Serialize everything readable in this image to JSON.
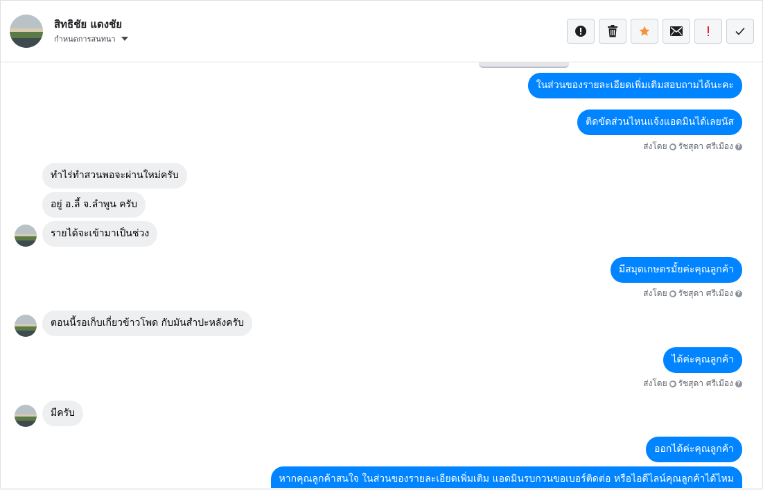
{
  "header": {
    "contact_name": "สิทธิชัย แดงชัย",
    "assign_label": "กำหนดการสนทนา",
    "avatar_icon": "landscape-avatar",
    "actions": [
      {
        "name": "report-spam-button",
        "icon": "exclamation-circle-icon"
      },
      {
        "name": "delete-button",
        "icon": "trash-icon"
      },
      {
        "name": "star-button",
        "icon": "star-icon"
      },
      {
        "name": "mark-unread-button",
        "icon": "envelope-icon"
      },
      {
        "name": "follow-up-button",
        "icon": "exclamation-icon"
      },
      {
        "name": "mark-done-button",
        "icon": "checkmark-icon"
      }
    ]
  },
  "colors": {
    "outgoing_bubble": "#0084ff",
    "incoming_bubble": "#eeeff1",
    "star": "#f7923b",
    "follow_up": "#e41e3f"
  },
  "messages": {
    "m1": "ในส่วนของรายละเอียดเพิ่มเติมสอบถามได้นะคะ",
    "m2": "ติดขัดส่วนไหนแจ้งแอดมินได้เลยนัส",
    "m3": "ทำไร่ทำสวนพอจะผ่านใหม่ครับ",
    "m4": "อยู่ อ.ลี้ จ.ลำพูน ครับ",
    "m5": "รายได้จะเข้ามาเป็นช่วง",
    "m6": "มีสมุดเกษตรมั้ยค่ะคุณลูกค้า",
    "m7": "ตอนนี้รอเก็บเกี่ยวข้าวโพด กับมันสำปะหลังครับ",
    "m8": "ได้ค่ะคุณลูกค้า",
    "m9": "มีครับ",
    "m10": "ออกได้ค่ะคุณลูกค้า",
    "m11": "หากคุณลูกค้าสนใจ ในส่วนของรายละเอียดเพิ่มเติม แอดมินรบกวนขอเบอร์ติดต่อ หรือไอดีไลน์คุณลูกค้าได้ไหม"
  },
  "sent_by": {
    "prefix": "ส่งโดย",
    "agent": "รัชสุดา ศรีเมือง"
  }
}
